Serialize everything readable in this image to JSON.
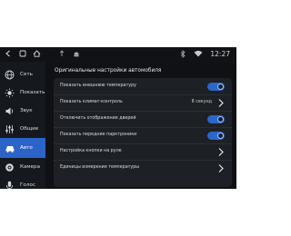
{
  "status_bar": {
    "icons": [
      "back-icon",
      "home-square-icon",
      "home-icon",
      "usb-icon",
      "android-icon",
      "bluetooth-icon",
      "wifi-icon"
    ],
    "time": "12:27"
  },
  "sidebar": {
    "items": [
      {
        "label": "Сеть",
        "icon": "network-globe-icon",
        "active": false
      },
      {
        "label": "Показать",
        "icon": "display-sun-icon",
        "active": false
      },
      {
        "label": "Звук",
        "icon": "speaker-icon",
        "active": false
      },
      {
        "label": "Общие",
        "icon": "general-sliders-icon",
        "active": false
      },
      {
        "label": "Авто",
        "icon": "car-icon",
        "active": true
      },
      {
        "label": "Камера",
        "icon": "camera-icon",
        "active": false
      },
      {
        "label": "Голос",
        "icon": "microphone-icon",
        "active": false
      }
    ]
  },
  "main": {
    "title": "Оригинальные настройки автомобиля",
    "rows": [
      {
        "label": "Показать внешнюю температуру",
        "control": "toggle",
        "on": true
      },
      {
        "label": "Показать климат-контроль",
        "control": "chevron",
        "value": "8 секунд"
      },
      {
        "label": "Отключить отображение дверей",
        "control": "toggle",
        "on": true
      },
      {
        "label": "Показать передние парктроники",
        "control": "toggle",
        "on": true
      },
      {
        "label": "Настройка кнопки на руле",
        "control": "chevron",
        "value": ""
      },
      {
        "label": "Единицы измерения температуры",
        "control": "chevron",
        "value": ""
      }
    ]
  },
  "colors": {
    "accent": "#2c63c9",
    "panel": "#1d2024",
    "background": "#0f1114"
  }
}
